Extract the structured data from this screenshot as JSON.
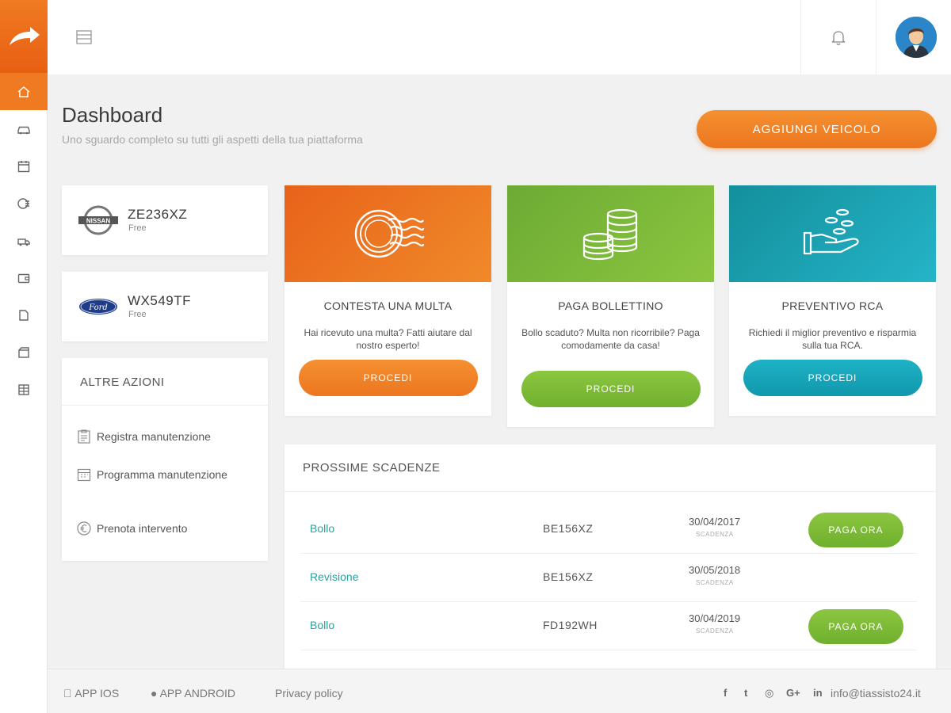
{
  "header": {
    "title": "Dashboard",
    "subtitle": "Uno sguardo completo su tutti gli aspetti della tua piattaforma",
    "add_vehicle_label": "AGGIUNGI VEICOLO"
  },
  "vehicles": [
    {
      "plate": "ZE236XZ",
      "plan": "Free",
      "brand_icon": "nissan-logo"
    },
    {
      "plate": "WX549TF",
      "plan": "Free",
      "brand_icon": "ford-logo"
    }
  ],
  "other_actions": {
    "title": "ALTRE AZIONI",
    "items": [
      {
        "label": "Registra manutenzione",
        "icon": "clipboard-icon"
      },
      {
        "label": "Programma manutenzione",
        "icon": "calendar-icon"
      },
      {
        "label": "Prenota intervento",
        "icon": "euro-icon"
      }
    ]
  },
  "services": [
    {
      "title": "CONTESTA UNA MULTA",
      "description": "Hai ricevuto una multa? Fatti aiutare dal nostro esperto!",
      "button": "PROCEDI",
      "icon": "stamp-icon",
      "color": "#ec6f1e"
    },
    {
      "title": "PAGA BOLLETTINO",
      "description": "Bollo scaduto? Multa non ricorribile? Paga comodamente da casa!",
      "button": "PROCEDI",
      "icon": "coins-icon",
      "color": "#7cb83a"
    },
    {
      "title": "PREVENTIVO RCA",
      "description": "Richiedi il miglior preventivo e risparmia sulla tua RCA.",
      "button": "PROCEDI",
      "icon": "hand-coins-icon",
      "color": "#1aa5b8"
    }
  ],
  "deadlines": {
    "title": "PROSSIME SCADENZE",
    "rows": [
      {
        "type": "Bollo",
        "plate": "BE156XZ",
        "date": "30/04/2017",
        "date_label": "SCADENZA",
        "action": "PAGA ORA"
      },
      {
        "type": "Revisione",
        "plate": "BE156XZ",
        "date": "30/05/2018",
        "date_label": "SCADENZA",
        "action": ""
      },
      {
        "type": "Bollo",
        "plate": "FD192WH",
        "date": "30/04/2019",
        "date_label": "SCADENZA",
        "action": "PAGA ORA"
      }
    ]
  },
  "footer": {
    "app_ios": "APP IOS",
    "app_android": "APP ANDROID",
    "privacy": "Privacy policy",
    "email": "info@tiassisto24.it"
  },
  "colors": {
    "accent": "#f07a22",
    "green": "#7cb83a",
    "teal": "#1aa5b8",
    "link": "#2aa0a0"
  }
}
